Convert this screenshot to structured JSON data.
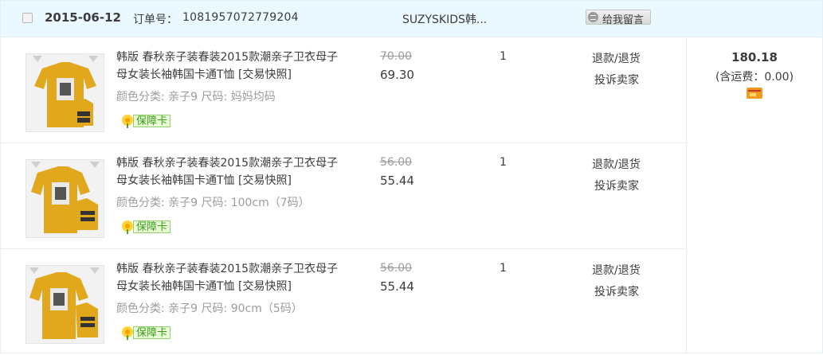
{
  "header": {
    "date": "2015-06-12",
    "order_label": "订单号：",
    "order_number": "1081957072779204",
    "shop_name": "SUZYSKIDS韩...",
    "message_button": "给我留言"
  },
  "items": [
    {
      "title": "韩版 春秋亲子装春装2015款潮亲子卫衣母子母女装长袖韩国卡通T恤 [交易快照]",
      "spec": "颜色分类: 亲子9 尺码: 妈妈均码",
      "badge": "保障卡",
      "original_price": "70.00",
      "price": "69.30",
      "quantity": "1",
      "action_refund": "退款/退货",
      "action_complain": "投诉卖家"
    },
    {
      "title": "韩版 春秋亲子装春装2015款潮亲子卫衣母子母女装长袖韩国卡通T恤 [交易快照]",
      "spec": "颜色分类: 亲子9 尺码: 100cm（7码）",
      "badge": "保障卡",
      "original_price": "56.00",
      "price": "55.44",
      "quantity": "1",
      "action_refund": "退款/退货",
      "action_complain": "投诉卖家"
    },
    {
      "title": "韩版 春秋亲子装春装2015款潮亲子卫衣母子母女装长袖韩国卡通T恤 [交易快照]",
      "spec": "颜色分类: 亲子9 尺码: 90cm（5码）",
      "badge": "保障卡",
      "original_price": "56.00",
      "price": "55.44",
      "quantity": "1",
      "action_refund": "退款/退货",
      "action_complain": "投诉卖家"
    }
  ],
  "summary": {
    "total": "180.18",
    "shipping": "(含运费：0.00)"
  },
  "icons": {
    "message": "speech-bubble-icon",
    "badge": "shield-flower-icon",
    "payment": "card-icon"
  },
  "colors": {
    "header_bg": "#eaf8ff",
    "badge_green": "#3b9a1c",
    "shirt_yellow": "#e1a81d"
  }
}
